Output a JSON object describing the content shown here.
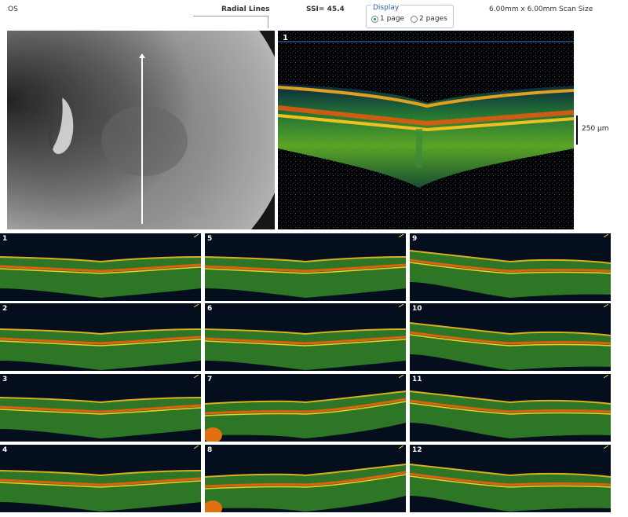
{
  "header": {
    "eye": "OS",
    "protocol": "Radial Lines",
    "ssi": "SSI= 45.4",
    "display_label": "Display",
    "option_1page": "1 page",
    "option_2pages": "2 pages",
    "scan_size": "6.00mm x 6.00mm Scan Size"
  },
  "main_scan": {
    "number": "1"
  },
  "scale": {
    "label": "250 µm"
  },
  "thumbnails": [
    {
      "number": "1"
    },
    {
      "number": "2"
    },
    {
      "number": "3"
    },
    {
      "number": "4"
    },
    {
      "number": "5"
    },
    {
      "number": "6"
    },
    {
      "number": "7"
    },
    {
      "number": "8"
    },
    {
      "number": "9"
    },
    {
      "number": "10"
    },
    {
      "number": "11"
    },
    {
      "number": "12"
    }
  ]
}
